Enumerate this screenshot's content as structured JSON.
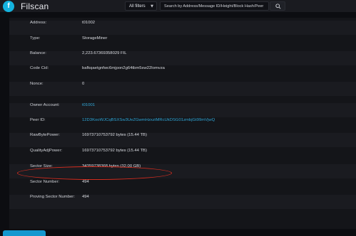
{
  "header": {
    "logo_glyph": "f",
    "brand": "Filscan",
    "filter_label": "All filters",
    "search_placeholder": "Search by Address/Message ID/Height/Block Hash/Peer"
  },
  "details": [
    {
      "label": "Address:",
      "value": "t01002",
      "link": false
    },
    {
      "label": "Type:",
      "value": "StorageMiner",
      "link": false
    },
    {
      "label": "Balance:",
      "value": "2,223.6736935802​9 FIL",
      "link": false
    },
    {
      "label": "Code Cid:",
      "value": "bafkqaetgnfwc6mjpon2g64tbm5sw22lomvza",
      "link": false
    },
    {
      "label": "Nonce:",
      "value": "0",
      "link": false
    },
    {
      "label": "Owner Account:",
      "value": "t01001",
      "link": true
    },
    {
      "label": "Peer ID:",
      "value": "12D3KooWJCqBSXSw3UeZGwmHzxztMRcUkDSG01zmbjGt99mVjwQ",
      "link": true
    },
    {
      "label": "RawBytePower:",
      "value": "16973710753792 bytes (15.44 TB)",
      "link": false
    },
    {
      "label": "QualityAdjPower:",
      "value": "16973710753792 bytes (15.44 TB)",
      "link": false
    },
    {
      "label": "Sector Size:",
      "value": "34359738368 bytes (32.00 GB)",
      "link": false
    },
    {
      "label": "Sector Number:",
      "value": "494",
      "link": false
    },
    {
      "label": "Proving Sector Number:",
      "value": "494",
      "link": false
    }
  ],
  "bottom_button_label": "",
  "colors": {
    "accent": "#2fa7d8",
    "logo": "#14b3df",
    "annotation": "#d62d1f"
  }
}
